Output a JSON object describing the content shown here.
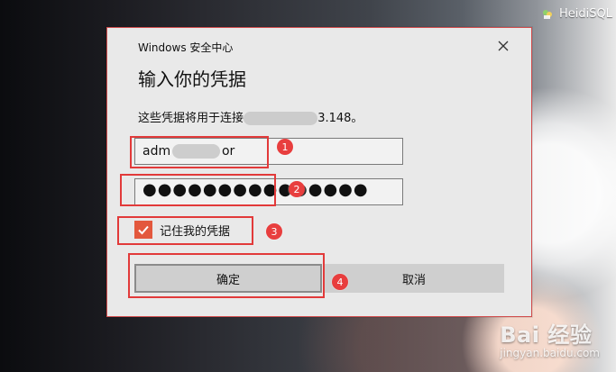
{
  "app": {
    "name": "HeidiSQL",
    "icon": "heidisql-icon"
  },
  "dialog": {
    "window_title": "Windows 安全中心",
    "heading": "输入你的凭据",
    "description_prefix": "这些凭据将用于连接",
    "description_suffix": "3.148。",
    "username": {
      "prefix": "adm",
      "suffix": "or"
    },
    "password_dots": "●●●●●●●●●●●●●●●",
    "remember_label": "记住我的凭据",
    "remember_checked": true,
    "ok_label": "确定",
    "cancel_label": "取消",
    "close_icon": "close-icon"
  },
  "annotations": {
    "step_1": "1",
    "step_2": "2",
    "step_3": "3",
    "step_4": "4"
  },
  "watermark": {
    "line1": "Bai 经验",
    "line2": "jingyan.baidu.com"
  },
  "colors": {
    "annotation_red": "#e23a3a",
    "checkbox_orange": "#e3583d"
  }
}
